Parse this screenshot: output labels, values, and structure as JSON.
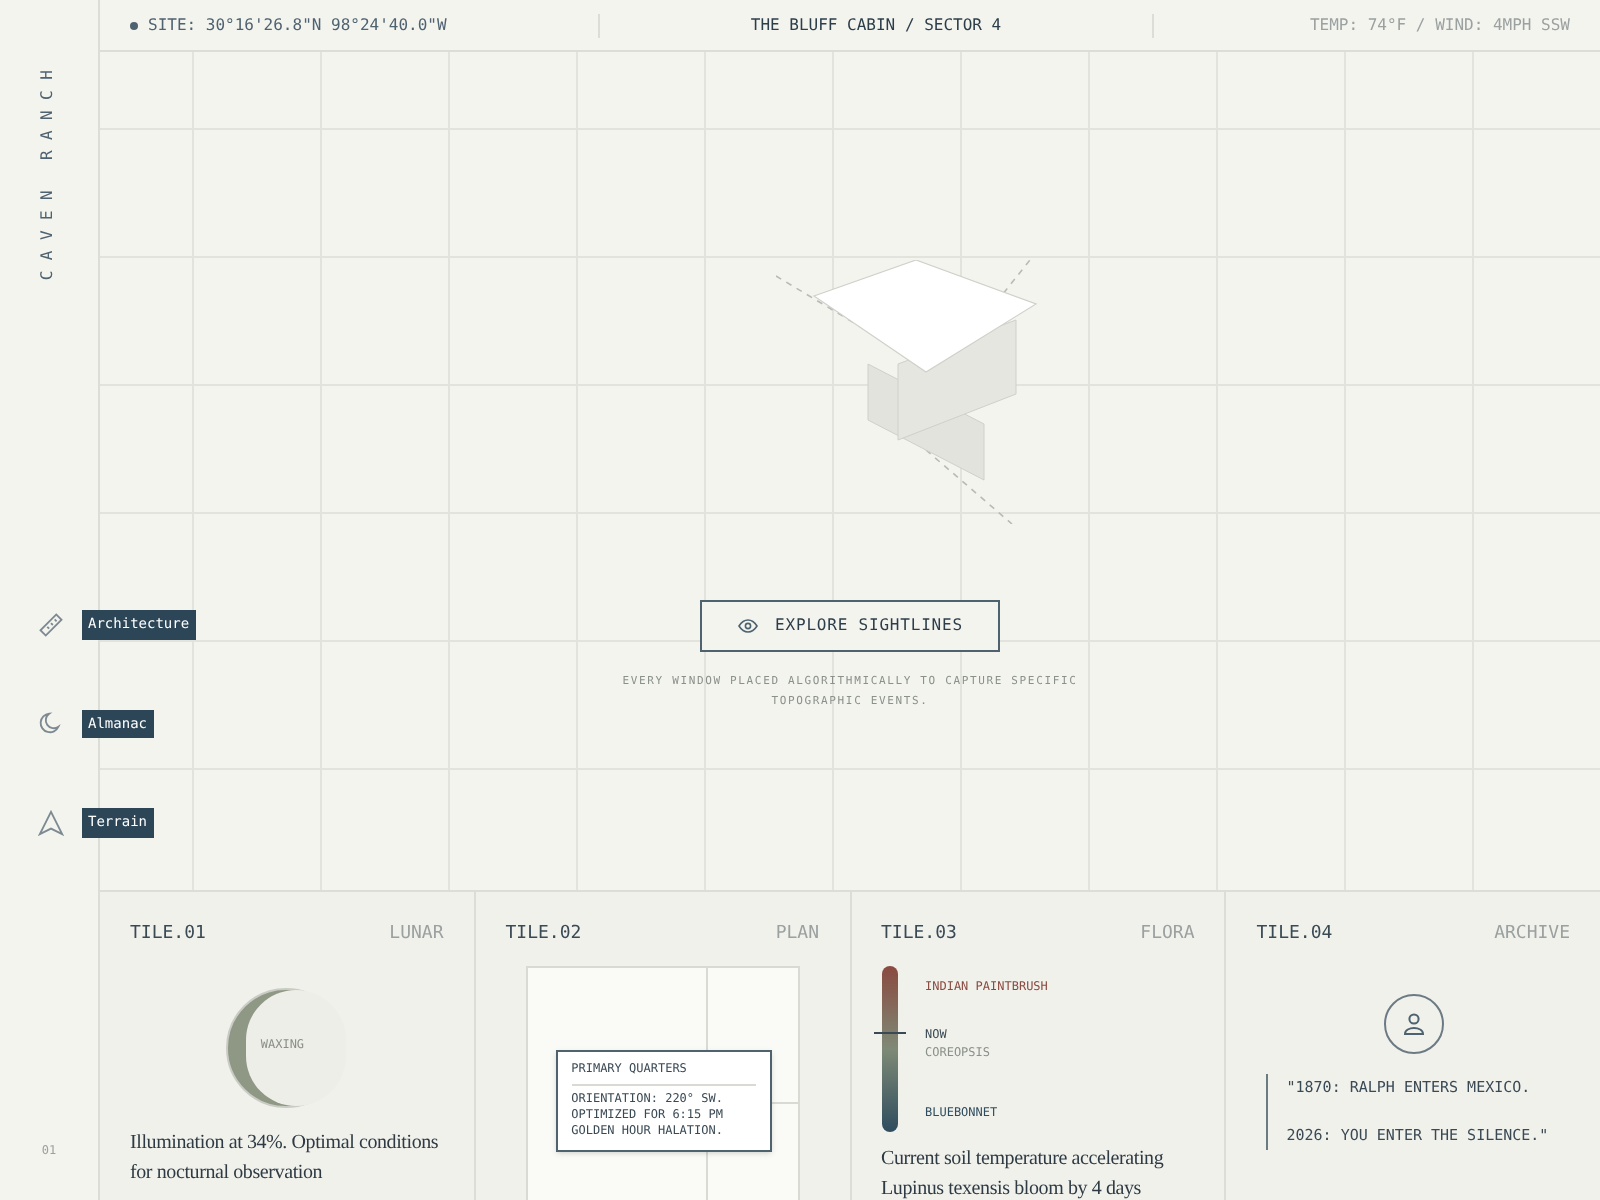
{
  "sidebar": {
    "brand": "CAVEN RANCH",
    "items": [
      {
        "kind": "ruler",
        "label": "Architecture"
      },
      {
        "kind": "moon",
        "label": "Almanac"
      },
      {
        "kind": "terrain",
        "label": "Terrain"
      }
    ],
    "page": "01"
  },
  "top_bar": {
    "site": "SITE: 30°16'26.8\"N 98°24'40.0\"W",
    "title": "THE BLUFF CABIN / SECTOR 4",
    "weather": "TEMP: 74°F / WIND: 4MPH SSW"
  },
  "hero": {
    "button": "EXPLORE SIGHTLINES",
    "caption": "EVERY WINDOW PLACED ALGORITHMICALLY TO CAPTURE SPECIFIC TOPOGRAPHIC EVENTS."
  },
  "tiles": [
    {
      "kind": "lunar",
      "id": "TILE.01",
      "tag": "LUNAR",
      "phase": "WAXING",
      "text": "Illumination at 34%. Optimal conditions for nocturnal observation"
    },
    {
      "kind": "plan",
      "id": "TILE.02",
      "tag": "PLAN",
      "card_title": "PRIMARY QUARTERS",
      "card_lines": [
        "ORIENTATION: 220° SW.",
        "OPTIMIZED FOR 6:15 PM",
        "GOLDEN HOUR HALATION."
      ]
    },
    {
      "kind": "flora",
      "id": "TILE.03",
      "tag": "FLORA",
      "top": "INDIAN PAINTBRUSH",
      "now": "NOW",
      "middle": "COREOPSIS",
      "bottom": "BLUEBONNET",
      "level": 0.6,
      "text": "Current soil temperature accelerating Lupinus texensis bloom by 4 days"
    },
    {
      "kind": "archive",
      "id": "TILE.04",
      "tag": "ARCHIVE",
      "quote": [
        "\"1870: RALPH ENTERS MEXICO.",
        "2026: YOU ENTER THE SILENCE.\""
      ]
    }
  ]
}
